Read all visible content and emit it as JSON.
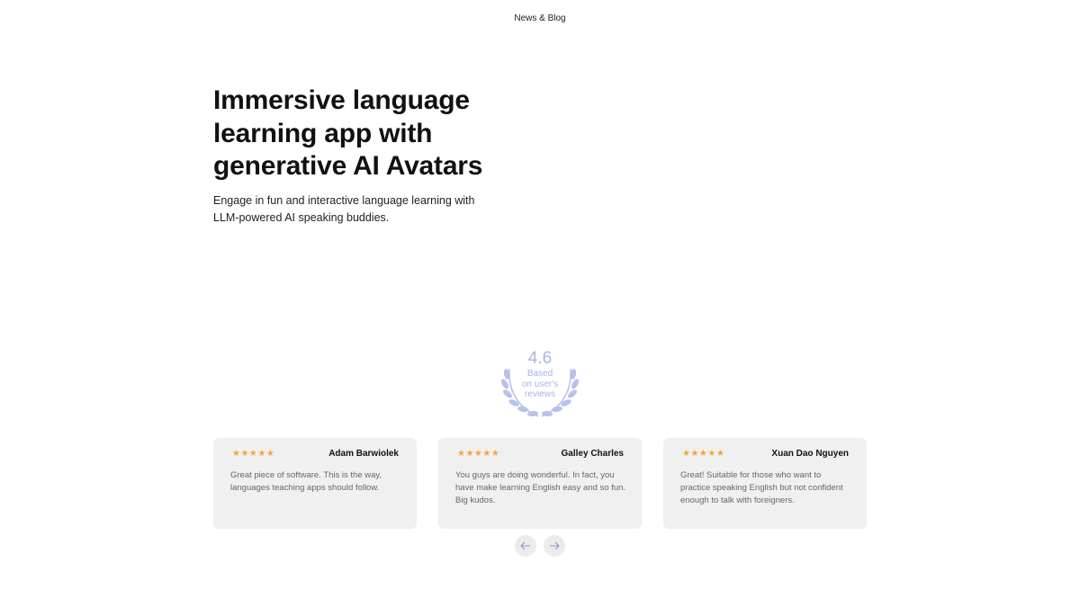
{
  "nav": {
    "link_label": "News & Blog"
  },
  "hero": {
    "title_line1": "Immersive language",
    "title_line2": "learning app with",
    "title_line3": "generative AI Avatars",
    "subtitle": "Engage in fun and interactive language learning with LLM-powered AI speaking buddies."
  },
  "rating": {
    "score": "4.6",
    "caption_line1": "Based",
    "caption_line2": "on user's",
    "caption_line3": "reviews",
    "color": "#aab4e4"
  },
  "reviews": [
    {
      "stars": "★★★★★",
      "rating": 5,
      "author": "Adam Barwiolek",
      "text": "Great piece of software. This is the way, languages teaching apps should follow."
    },
    {
      "stars": "★★★★★",
      "rating": 5,
      "author": "Galley Charles",
      "text": "You guys are doing wonderful. In fact, you have make learning English easy and so fun. Big kudos."
    },
    {
      "stars": "★★★★★",
      "rating": 5,
      "author": "Xuan Dao Nguyen",
      "text": "Great! Suitable for those who want to practice speaking English but not confident enough to talk with foreigners."
    }
  ],
  "carousel": {
    "prev_icon": "arrow-left-icon",
    "next_icon": "arrow-right-icon"
  },
  "colors": {
    "star": "#f2a73b",
    "card_bg": "#f0f0f0",
    "accent": "#aab4e4"
  }
}
